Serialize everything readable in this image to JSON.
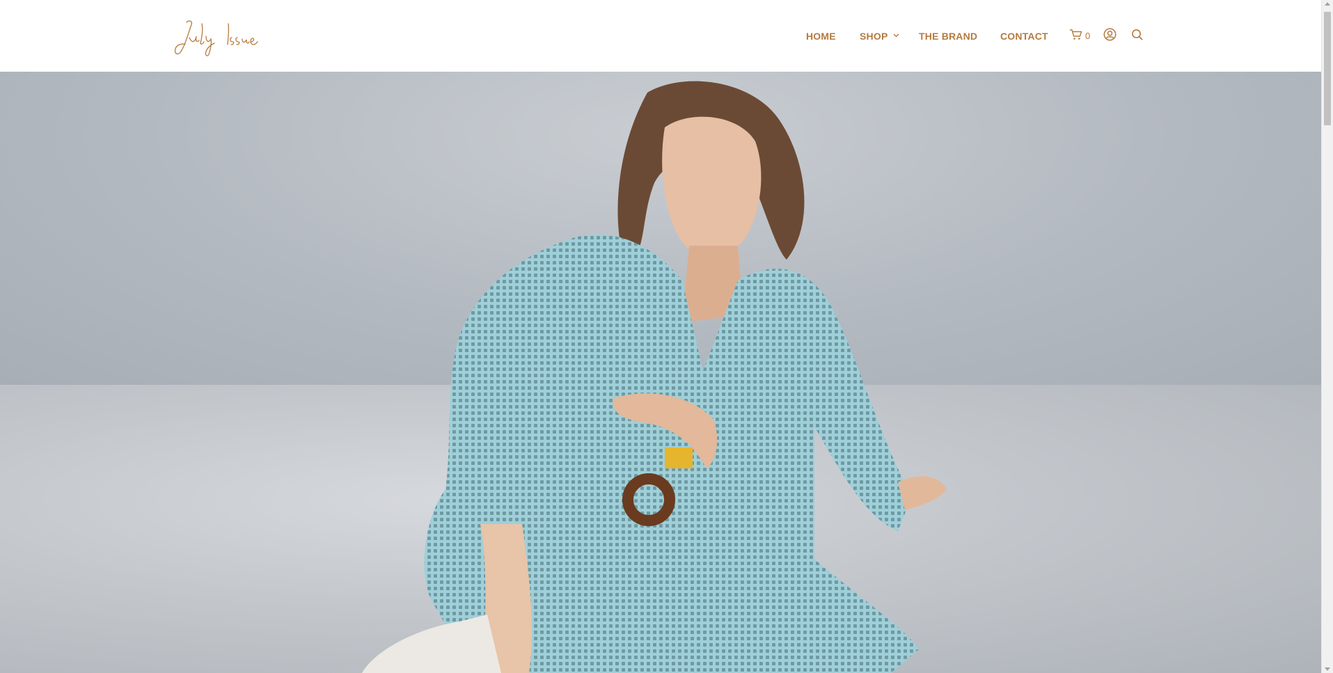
{
  "brand": {
    "logo_text": "July Issue"
  },
  "nav": {
    "home": "HOME",
    "shop": "SHOP",
    "brand": "THE BRAND",
    "contact": "CONTACT"
  },
  "cart": {
    "count": "0",
    "icon": "shopping-cart-icon"
  },
  "icons": {
    "account": "user-circle-icon",
    "search": "search-icon",
    "dropdown": "chevron-down-icon"
  },
  "colors": {
    "accent": "#b57a3f",
    "header_bg": "#ffffff"
  }
}
